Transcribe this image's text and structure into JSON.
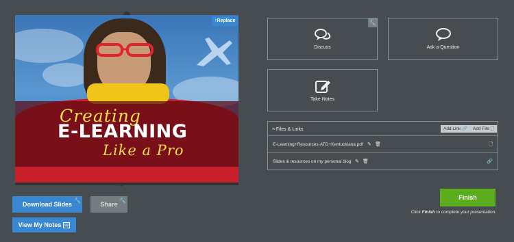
{
  "slide": {
    "line1": "Creating",
    "line2": "E-LEARNING",
    "line3": "Like a Pro",
    "replace_label": "Replace"
  },
  "buttons": {
    "download": "Download Slides",
    "share": "Share",
    "view_notes": "View My Notes"
  },
  "cards": {
    "discuss": "Discuss",
    "ask": "Ask a Question",
    "notes": "Take Notes"
  },
  "files": {
    "title": "Files & Links",
    "add_link": "Add Link",
    "add_file": "Add File",
    "items": [
      {
        "name": "E-Learning+Resources-ATD+Kentuckiana.pdf",
        "type_icon": "file-icon"
      },
      {
        "name": "Slides & resources on my personal blog",
        "type_icon": "link-icon"
      }
    ]
  },
  "finish": {
    "label": "Finish",
    "note_prefix": "Click ",
    "note_bold": "Finish",
    "note_suffix": " to complete your presentation."
  },
  "colors": {
    "background": "#464c4f",
    "primary_blue": "#3a87d1",
    "finish_green": "#5cad1e",
    "share_gray": "#767d80"
  }
}
